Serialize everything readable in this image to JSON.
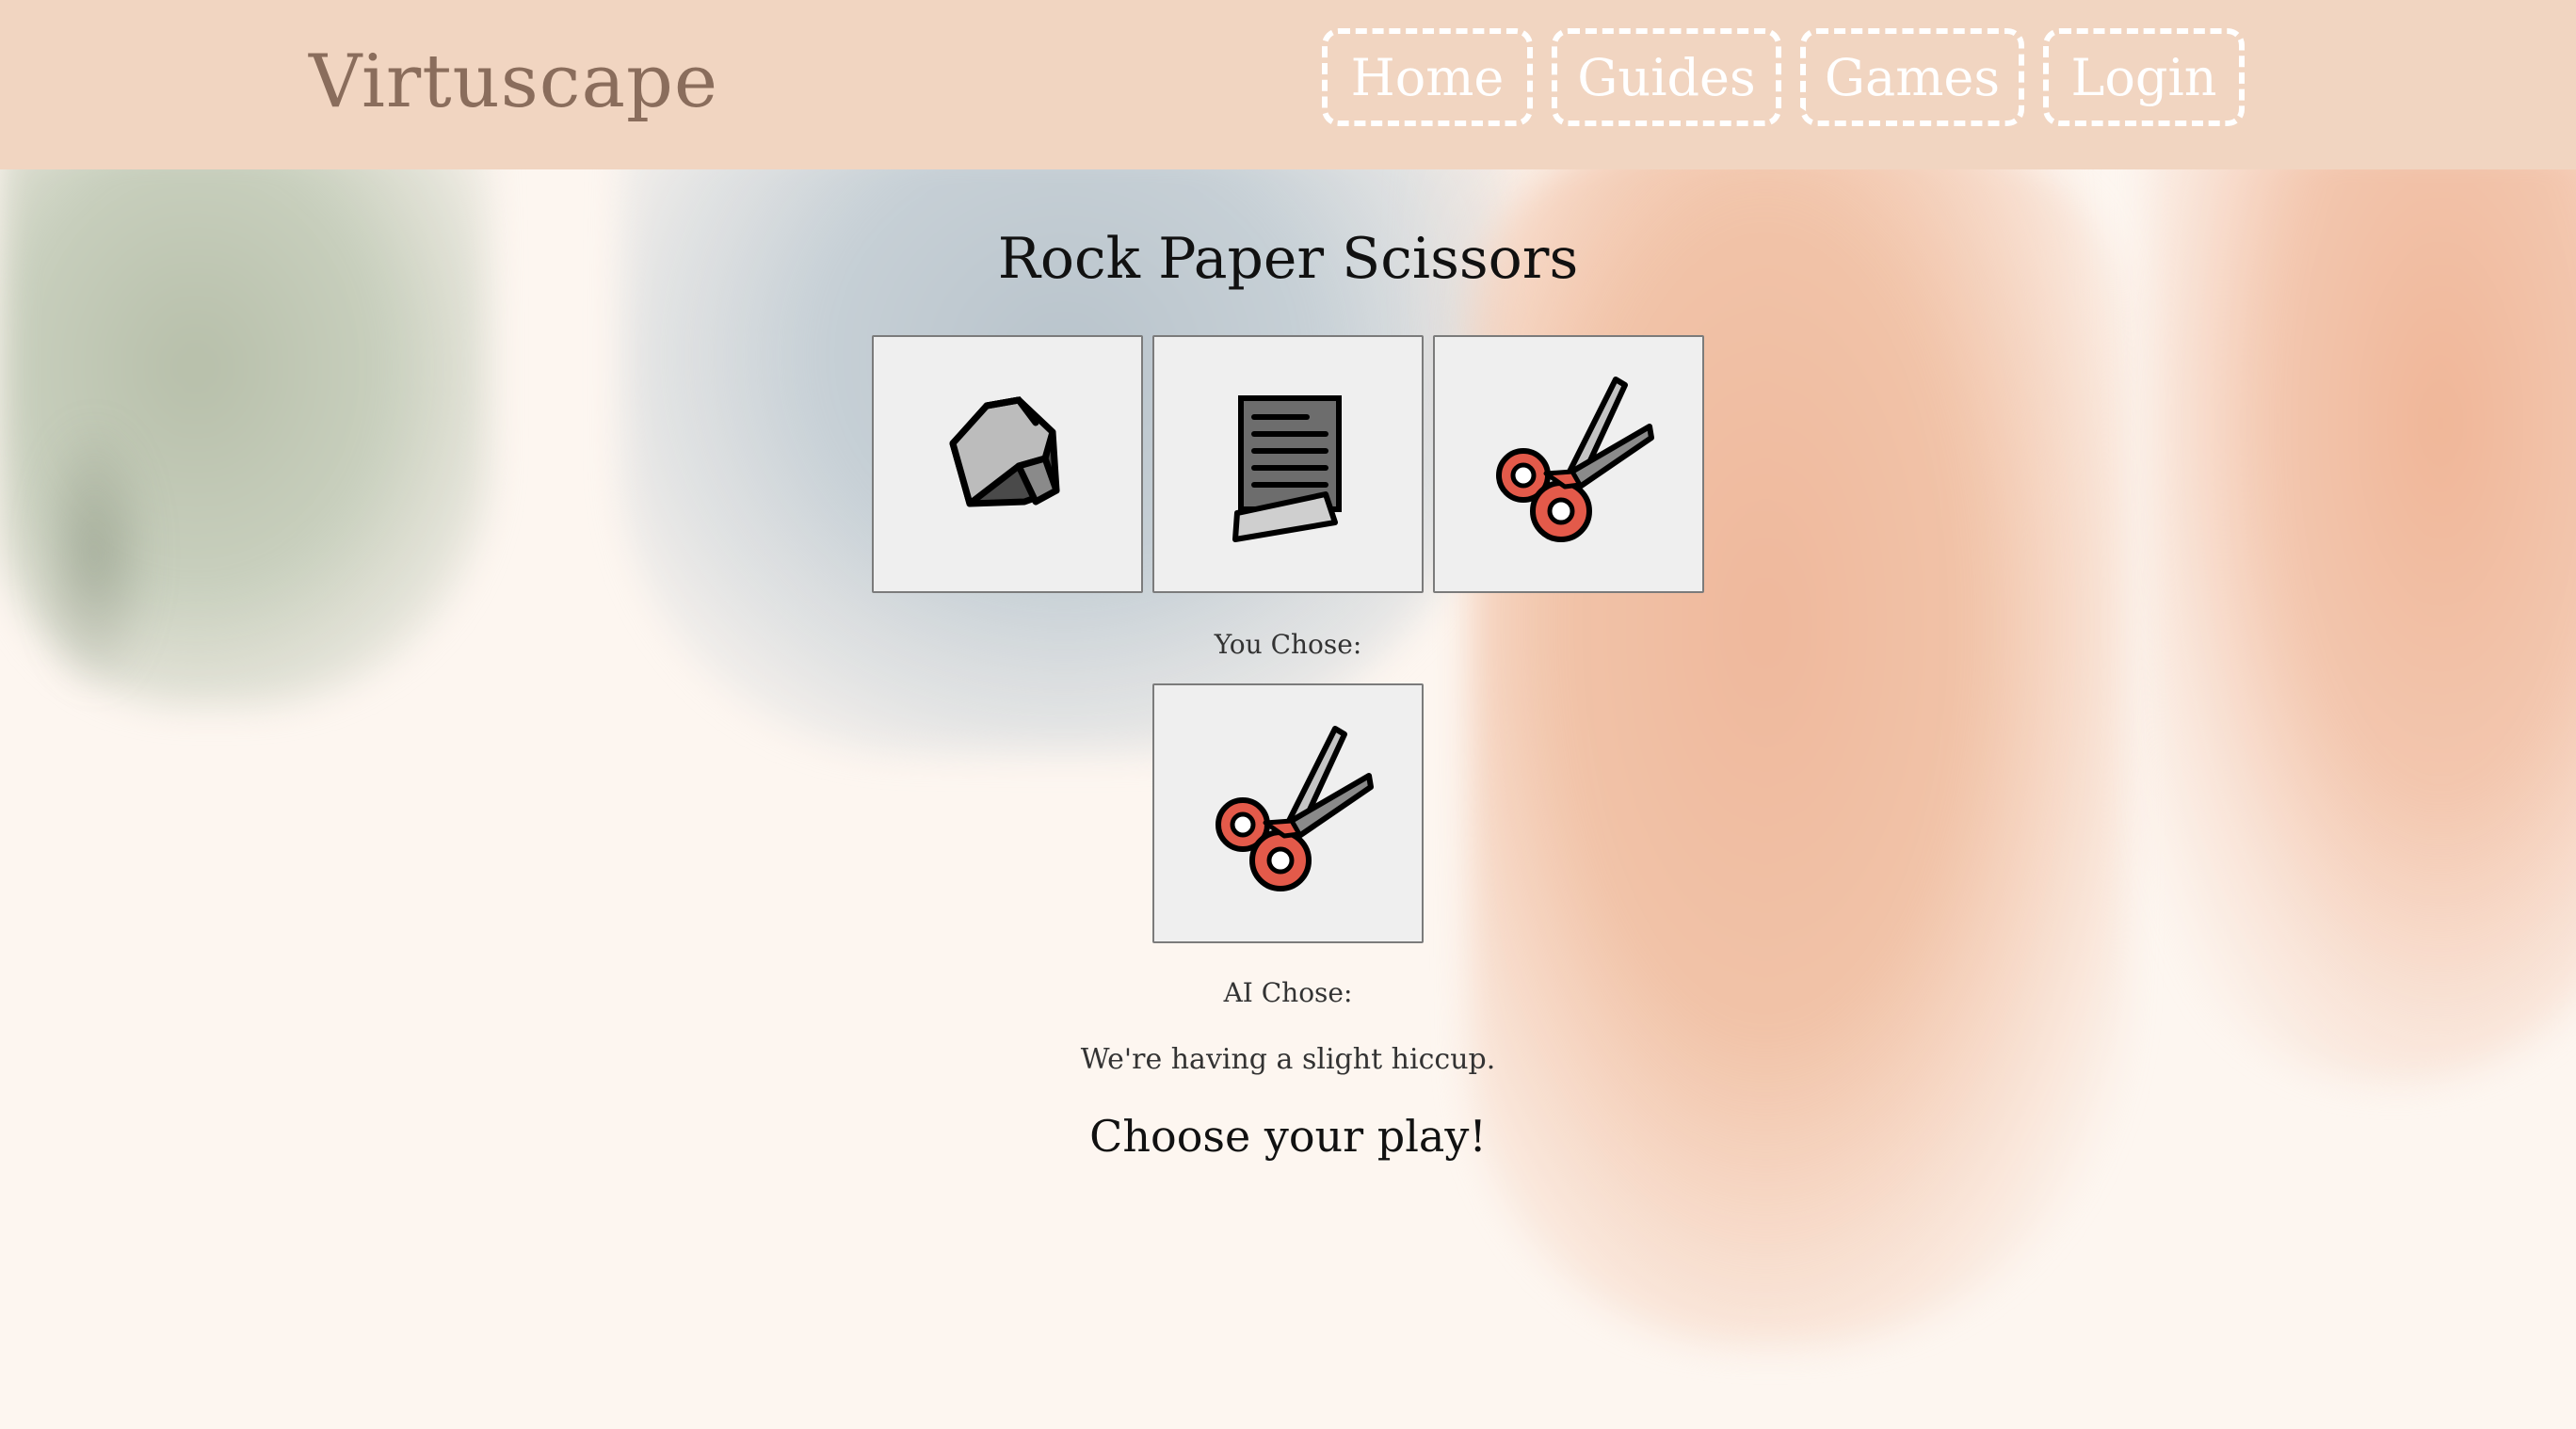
{
  "header": {
    "brand": "Virtuscape",
    "nav": [
      {
        "label": "Home"
      },
      {
        "label": "Guides"
      },
      {
        "label": "Games"
      },
      {
        "label": "Login"
      }
    ]
  },
  "game": {
    "title": "Rock Paper Scissors",
    "choices": [
      {
        "name": "rock",
        "icon": "rock-icon"
      },
      {
        "name": "paper",
        "icon": "paper-icon"
      },
      {
        "name": "scissors",
        "icon": "scissors-icon"
      }
    ],
    "you_chose_label": "You Chose:",
    "you_chose_icon": "scissors-icon",
    "ai_chose_label": "AI Chose:",
    "status_message": "We're having a slight hiccup.",
    "prompt": "Choose your play!"
  },
  "colors": {
    "header_bg": "#f1d5c1",
    "brand": "#8a6d5c",
    "nav_text": "#ffffff",
    "tile_bg": "#efefef",
    "scissors_red": "#e35a4a"
  }
}
